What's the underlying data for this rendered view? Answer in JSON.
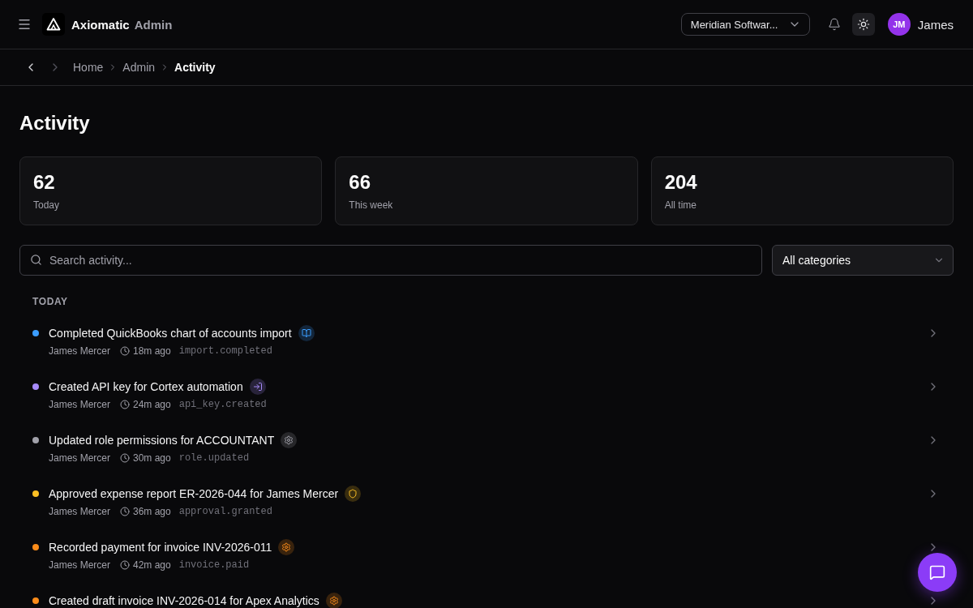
{
  "header": {
    "brand": {
      "name": "Axiomatic",
      "suffix": "Admin"
    },
    "workspace": "Meridian Softwar...",
    "user": {
      "initials": "JM",
      "name": "James"
    }
  },
  "history": {
    "back_disabled": false,
    "forward_disabled": true
  },
  "breadcrumb": [
    {
      "label": "Home",
      "current": false
    },
    {
      "label": "Admin",
      "current": false
    },
    {
      "label": "Activity",
      "current": true
    }
  ],
  "title": "Activity",
  "stats": [
    {
      "value": "62",
      "label": "Today"
    },
    {
      "value": "66",
      "label": "This week"
    },
    {
      "value": "204",
      "label": "All time"
    }
  ],
  "search": {
    "placeholder": "Search activity..."
  },
  "category_filter": {
    "value": "All categories"
  },
  "groups": [
    {
      "heading": "TODAY",
      "items": [
        {
          "kind": "import",
          "color": "#3b9dff",
          "title": "Completed QuickBooks chart of accounts import",
          "author": "James Mercer",
          "time": "18m ago",
          "event": "import.completed"
        },
        {
          "kind": "integration",
          "color": "#a78bfa",
          "title": "Created API key for Cortex automation",
          "author": "James Mercer",
          "time": "24m ago",
          "event": "api_key.created"
        },
        {
          "kind": "role",
          "color": "#a1a1aa",
          "title": "Updated role permissions for ACCOUNTANT",
          "author": "James Mercer",
          "time": "30m ago",
          "event": "role.updated"
        },
        {
          "kind": "approval",
          "color": "#fbbf24",
          "title": "Approved expense report ER-2026-044 for James Mercer",
          "author": "James Mercer",
          "time": "36m ago",
          "event": "approval.granted"
        },
        {
          "kind": "invoice",
          "color": "#fb8c1a",
          "title": "Recorded payment for invoice INV-2026-011",
          "author": "James Mercer",
          "time": "42m ago",
          "event": "invoice.paid"
        },
        {
          "kind": "invoice",
          "color": "#fb8c1a",
          "title": "Created draft invoice INV-2026-014 for Apex Analytics"
        }
      ]
    }
  ]
}
